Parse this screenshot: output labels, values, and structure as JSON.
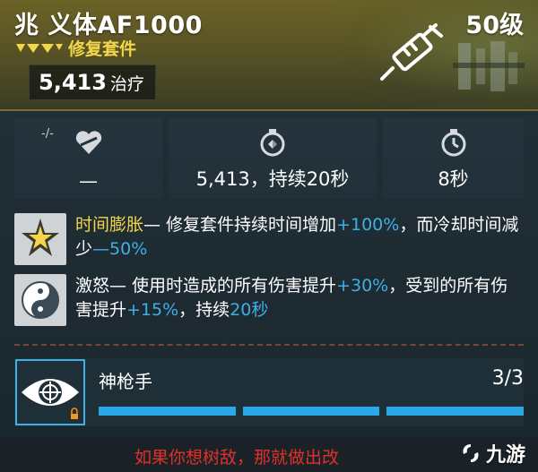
{
  "item": {
    "name": "兆 义体AF1000",
    "level": "50级",
    "type": "修复套件",
    "heal_value": "5,413",
    "heal_label": "治疗",
    "rarity_color": "#f3d64a"
  },
  "stats": {
    "stat1": {
      "icon": "heart-dash-icon",
      "small_label": "-/-",
      "value": "—"
    },
    "stat2": {
      "icon": "timer-arrows-icon",
      "value": "5,413，持续20秒"
    },
    "stat3": {
      "icon": "stopwatch-icon",
      "value": "8秒"
    }
  },
  "perks": [
    {
      "icon": "star-burst-icon",
      "name": "时间膨胀",
      "sep": "—",
      "part1": " 修复套件持续时间增加",
      "blue1": "+100%",
      "part2": "，而冷却时间减少",
      "blue2": "—50%"
    },
    {
      "icon": "yin-yang-icon",
      "name": "激怒",
      "sep": "—",
      "part1": " 使用时造成的所有伤害提升",
      "blue1": "+30%",
      "part2": "，受到的所有伤害提升",
      "blue2": "+15%",
      "part3": "，持续",
      "blue3": "20秒"
    }
  ],
  "set": {
    "icon": "eye-target-icon",
    "name": "神枪手",
    "count": "3/3"
  },
  "footer": {
    "flavor": "如果你想树敌，那就做出改",
    "brand": "九游"
  },
  "colors": {
    "accent_blue": "#2aa7e5",
    "gold": "#f3d64a",
    "flavor_red": "#e0302a"
  }
}
